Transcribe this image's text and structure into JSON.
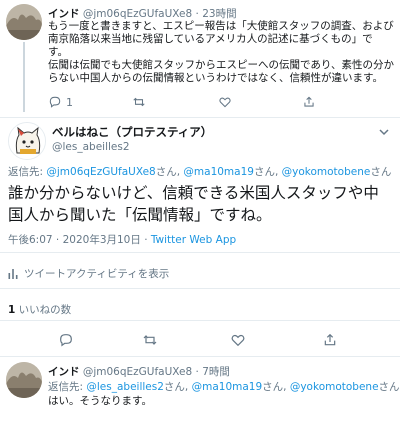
{
  "tweet1": {
    "name": "インド",
    "handle": "@jm06qEzGUfaUXe8",
    "sep": "·",
    "time": "23時間",
    "lines": [
      "もう一度と書きますと、エスピー報告は「大使館スタッフの調査、および",
      "南京陥落以来当地に残留しているアメリカ人の記述に基づくもの」で",
      "す。",
      "伝聞は伝聞でも大使館スタッフからエスピーへの伝聞であり、素性の分か",
      "らない中国人からの伝聞情報というわけではなく、信頼性が違います。"
    ],
    "reply_count": "1",
    "retweet_count": "",
    "like_count": ""
  },
  "main": {
    "name": "ベルはねこ（プロテスティア）",
    "handle": "@les_abeilles2",
    "reply_prefix": "返信先: ",
    "mention1": "@jm06qEzGUfaUXe8",
    "san1": "さん, ",
    "mention2": "@ma10ma19",
    "san2": "さん, ",
    "mention3": "@yokomotobene",
    "san3": "さん",
    "text_lines": [
      "誰か分からないけど、信頼できる米国人スタッフや中",
      "国人から聞いた「伝聞情報」ですね。"
    ],
    "timestamp": "午後6:07 · 2020年3月10日",
    "dot": " · ",
    "client": "Twitter Web App",
    "activity_label": "ツイートアクティビティを表示",
    "like_num": "1",
    "like_label": " いいねの数"
  },
  "tweet3": {
    "name": "インド",
    "handle": "@jm06qEzGUfaUXe8",
    "sep": "·",
    "time": "7時間",
    "reply_prefix": "返信先: ",
    "mention1": "@les_abeilles2",
    "san1": "さん, ",
    "mention2": "@ma10ma19",
    "san2": "さん, ",
    "mention3": "@yokomotobene",
    "san3": "さん",
    "text": "はい。そうなります。"
  },
  "colors": {
    "link": "#1b95e0",
    "secondary": "#657786",
    "border": "#e6ecf0"
  },
  "icons": [
    "reply-icon",
    "retweet-icon",
    "like-icon",
    "share-icon",
    "activity-icon",
    "chevron-down-icon"
  ]
}
